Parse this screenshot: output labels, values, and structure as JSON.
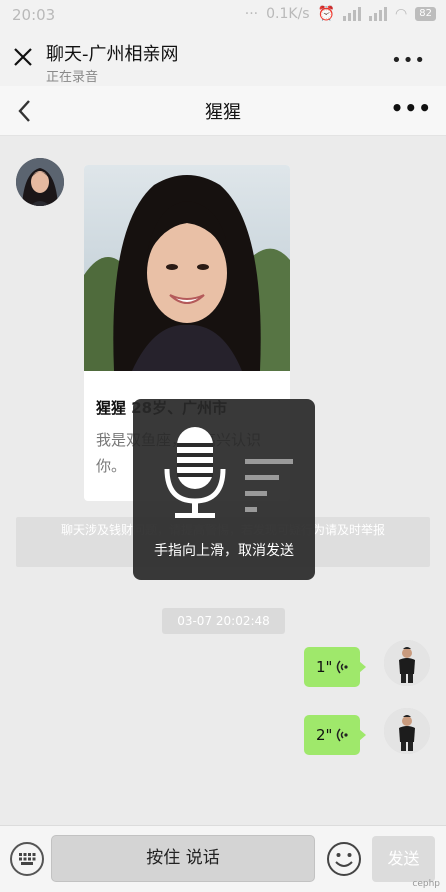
{
  "status": {
    "time": "20:03",
    "net_speed": "0.1K/s",
    "battery": "82"
  },
  "app": {
    "title": "聊天-广州相亲网",
    "subtitle": "正在录音"
  },
  "chat": {
    "contact_name": "猩猩"
  },
  "card": {
    "name_line": "猩猩 28岁、广州市",
    "intro": "我是双鱼座，很高兴认识你。"
  },
  "notice_text": "聊天涉及钱财问题，请提高警惕，若发现可疑行为请及时举报",
  "timestamp": "03-07 20:02:48",
  "messages": [
    {
      "duration": "1\""
    },
    {
      "duration": "2\""
    }
  ],
  "recording": {
    "hint": "手指向上滑，取消发送"
  },
  "input": {
    "hold_label": "按住 说话",
    "send_label": "发送"
  },
  "watermark": "cephp"
}
